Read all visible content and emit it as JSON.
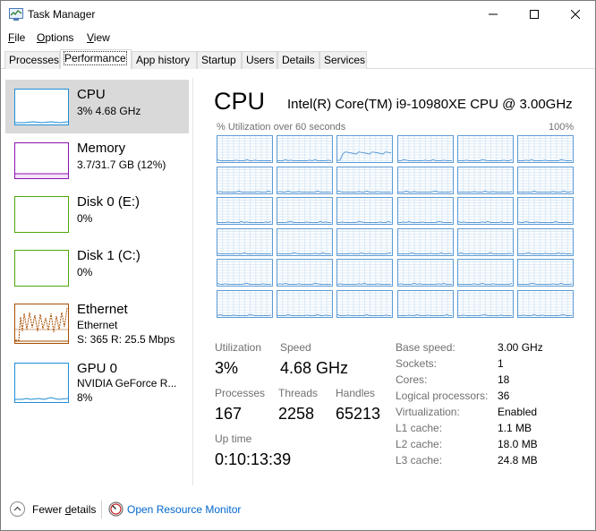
{
  "window": {
    "title": "Task Manager",
    "minimize_glyph": "—",
    "maximize_glyph": "☐",
    "close_glyph": "✕"
  },
  "menu": [
    {
      "label": "File",
      "accelerator": "F",
      "rest": "ile"
    },
    {
      "label": "Options",
      "accelerator": "O",
      "rest": "ptions"
    },
    {
      "label": "View",
      "accelerator": "V",
      "rest": "iew"
    }
  ],
  "tabs": [
    {
      "label": "Processes",
      "active": false
    },
    {
      "label": "Performance",
      "active": true
    },
    {
      "label": "App history",
      "active": false
    },
    {
      "label": "Startup",
      "active": false
    },
    {
      "label": "Users",
      "active": false
    },
    {
      "label": "Details",
      "active": false
    },
    {
      "label": "Services",
      "active": false
    }
  ],
  "sidebar": {
    "items": [
      {
        "title": "CPU",
        "sub1": "3% 4.68 GHz",
        "sub2": "",
        "sub3": "",
        "color": "#1f8dd6",
        "selected": true
      },
      {
        "title": "Memory",
        "sub1": "3.7/31.7 GB (12%)",
        "sub2": "",
        "sub3": "",
        "color": "#8b12ae",
        "selected": false
      },
      {
        "title": "Disk 0 (E:)",
        "sub1": "0%",
        "sub2": "",
        "sub3": "",
        "color": "#4da60c",
        "selected": false
      },
      {
        "title": "Disk 1 (C:)",
        "sub1": "0%",
        "sub2": "",
        "sub3": "",
        "color": "#4da60c",
        "selected": false
      },
      {
        "title": "Ethernet",
        "sub1": "Ethernet",
        "sub2": "S: 365  R: 25.5 Mbps",
        "sub3": "",
        "color": "#a74f01",
        "selected": false
      },
      {
        "title": "GPU 0",
        "sub1": "NVIDIA GeForce R...",
        "sub2": "8%",
        "sub3": "",
        "color": "#1f8dd6",
        "selected": false
      }
    ]
  },
  "main": {
    "heading": "CPU",
    "model": "Intel(R) Core(TM) i9-10980XE CPU @ 3.00GHz",
    "graph_label": "% Utilization over 60 seconds",
    "graph_max": "100%",
    "graph_color": "#5d9bd5",
    "logical_graph_count": 36,
    "stats": {
      "utilization_label": "Utilization",
      "utilization_value": "3%",
      "speed_label": "Speed",
      "speed_value": "4.68 GHz",
      "processes_label": "Processes",
      "processes_value": "167",
      "threads_label": "Threads",
      "threads_value": "2258",
      "handles_label": "Handles",
      "handles_value": "65213",
      "uptime_label": "Up time",
      "uptime_value": "0:10:13:39"
    },
    "specs": [
      {
        "label": "Base speed:",
        "value": "3.00 GHz"
      },
      {
        "label": "Sockets:",
        "value": "1"
      },
      {
        "label": "Cores:",
        "value": "18"
      },
      {
        "label": "Logical processors:",
        "value": "36"
      },
      {
        "label": "Virtualization:",
        "value": "Enabled"
      },
      {
        "label": "L1 cache:",
        "value": "1.1 MB"
      },
      {
        "label": "L2 cache:",
        "value": "18.0 MB"
      },
      {
        "label": "L3 cache:",
        "value": "24.8 MB"
      }
    ]
  },
  "footer": {
    "fewer_details": "Fewer details",
    "fewer_accelerator": "d",
    "fewer_prefix": "Fewer ",
    "fewer_suffix": "etails",
    "open_resource_monitor": "Open Resource Monitor"
  }
}
